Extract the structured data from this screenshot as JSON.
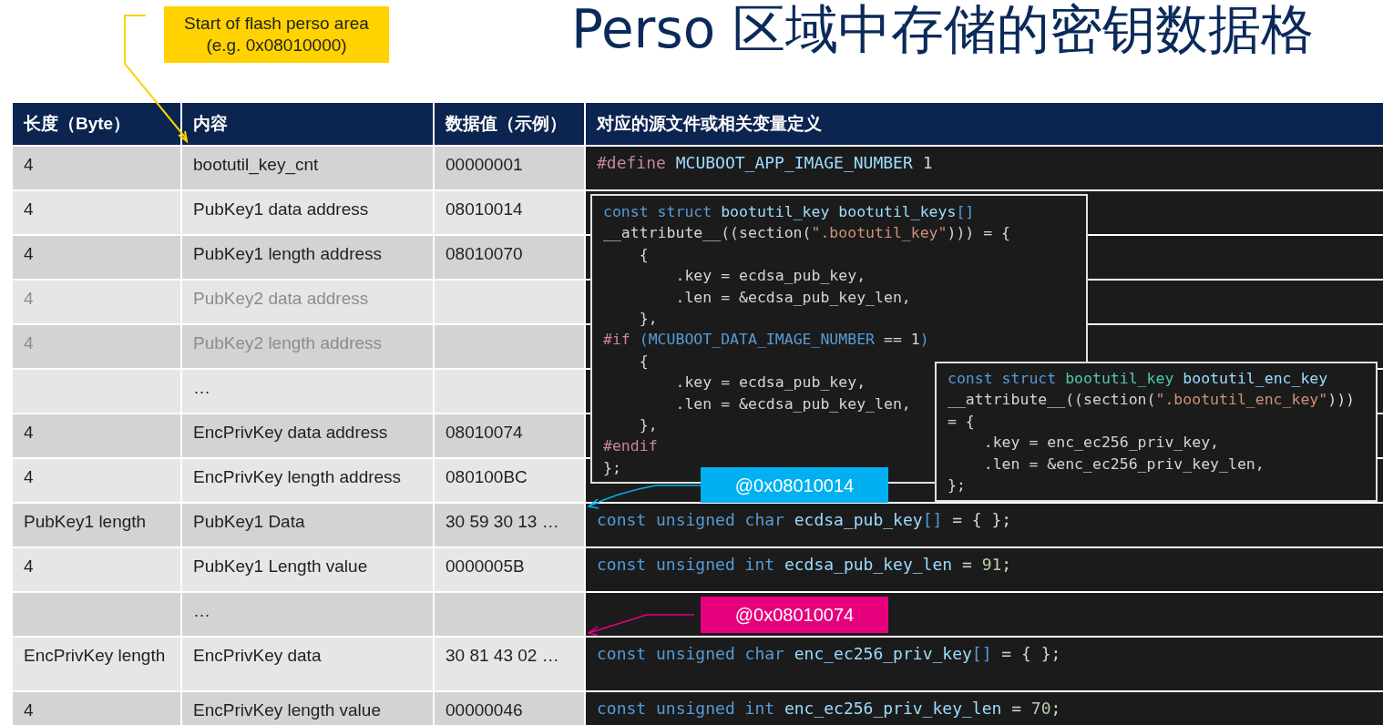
{
  "title": "Perso 区域中存储的密钥数据格",
  "callouts": [
    {
      "text": "Start of flash perso area",
      "subtext": "(e.g. 0x08010000)",
      "color": "#ffd200"
    },
    {
      "text": "@0x08010014",
      "color": "#00b0f0"
    },
    {
      "text": "@0x08010074",
      "color": "#e6007e"
    }
  ],
  "table": {
    "columns": [
      "长度（Byte）",
      "内容",
      "数据值（示例）",
      "对应的源文件或相关变量定义"
    ],
    "rows": [
      {
        "cells": [
          "4",
          "bootutil_key_cnt",
          "00000001"
        ],
        "disabled": false,
        "code": [
          {
            "kind": "pre",
            "text": "#define "
          },
          {
            "kind": "id",
            "text": "MCUBOOT_APP_IMAGE_NUMBER"
          },
          {
            "kind": "plain",
            "text": " 1"
          }
        ]
      },
      {
        "cells": [
          "4",
          "PubKey1 data address",
          "08010014"
        ],
        "disabled": false
      },
      {
        "cells": [
          "4",
          "PubKey1 length address",
          "08010070"
        ],
        "disabled": false
      },
      {
        "cells": [
          "4",
          "PubKey2 data address",
          ""
        ],
        "disabled": true
      },
      {
        "cells": [
          "4",
          "PubKey2 length address",
          ""
        ],
        "disabled": true
      },
      {
        "cells": [
          "",
          "…",
          ""
        ],
        "disabled": false
      },
      {
        "cells": [
          "4",
          "EncPrivKey data address",
          "08010074"
        ],
        "disabled": false
      },
      {
        "cells": [
          "4",
          "EncPrivKey length address",
          "080100BC"
        ],
        "disabled": false
      },
      {
        "cells": [
          "PubKey1 length",
          "PubKey1 Data",
          "30 59 30 13 …"
        ],
        "disabled": false,
        "code": [
          {
            "kind": "kw",
            "text": "const unsigned char "
          },
          {
            "kind": "id",
            "text": "ecdsa_pub_key"
          },
          {
            "kind": "kw",
            "text": "[]"
          },
          {
            "kind": "plain",
            "text": " = { };"
          }
        ]
      },
      {
        "cells": [
          "4",
          "PubKey1 Length value",
          "0000005B"
        ],
        "disabled": false,
        "code": [
          {
            "kind": "kw",
            "text": "const unsigned int "
          },
          {
            "kind": "id",
            "text": "ecdsa_pub_key_len"
          },
          {
            "kind": "plain",
            "text": " = "
          },
          {
            "kind": "num",
            "text": "91"
          },
          {
            "kind": "plain",
            "text": ";"
          }
        ]
      },
      {
        "cells": [
          "",
          "…",
          ""
        ],
        "disabled": false
      },
      {
        "cells": [
          "EncPrivKey length",
          "EncPrivKey data",
          "30 81 43 02 …"
        ],
        "disabled": false,
        "code": [
          {
            "kind": "kw",
            "text": "const unsigned char "
          },
          {
            "kind": "id",
            "text": "enc_ec256_priv_key"
          },
          {
            "kind": "kw",
            "text": "[]"
          },
          {
            "kind": "plain",
            "text": " = { };"
          }
        ]
      },
      {
        "cells": [
          "4",
          "EncPrivKey length value",
          "00000046"
        ],
        "disabled": false,
        "code": [
          {
            "kind": "kw",
            "text": "const unsigned int "
          },
          {
            "kind": "id",
            "text": "enc_ec256_priv_key_len"
          },
          {
            "kind": "plain",
            "text": " = "
          },
          {
            "kind": "num",
            "text": "70"
          },
          {
            "kind": "plain",
            "text": ";"
          }
        ]
      }
    ]
  },
  "code_boxes": [
    {
      "lines": [
        [
          {
            "kind": "kw",
            "text": "const struct "
          },
          {
            "kind": "id",
            "text": "bootutil_key bootutil_keys"
          },
          {
            "kind": "kw",
            "text": "[]"
          }
        ],
        [
          {
            "kind": "plain",
            "text": "__attribute__((section("
          },
          {
            "kind": "str",
            "text": "\".bootutil_key\""
          },
          {
            "kind": "plain",
            "text": "))) = {"
          }
        ],
        [
          {
            "kind": "plain",
            "text": "    {"
          }
        ],
        [
          {
            "kind": "plain",
            "text": "        .key = ecdsa_pub_key,"
          }
        ],
        [
          {
            "kind": "plain",
            "text": "        .len = &ecdsa_pub_key_len,"
          }
        ],
        [
          {
            "kind": "plain",
            "text": "    },"
          }
        ],
        [
          {
            "kind": "pre",
            "text": "#if "
          },
          {
            "kind": "kw",
            "text": "(MCUBOOT_DATA_IMAGE_NUMBER"
          },
          {
            "kind": "plain",
            "text": " == 1"
          },
          {
            "kind": "kw",
            "text": ")"
          }
        ],
        [
          {
            "kind": "plain",
            "text": "    {"
          }
        ],
        [
          {
            "kind": "plain",
            "text": "        .key = ecdsa_pub_key,"
          }
        ],
        [
          {
            "kind": "plain",
            "text": "        .len = &ecdsa_pub_key_len,"
          }
        ],
        [
          {
            "kind": "plain",
            "text": "    },"
          }
        ],
        [
          {
            "kind": "pre",
            "text": "#endif"
          }
        ],
        [
          {
            "kind": "plain",
            "text": "};"
          }
        ]
      ]
    },
    {
      "lines": [
        [
          {
            "kind": "kw",
            "text": "const struct "
          },
          {
            "kind": "type",
            "text": "bootutil_key"
          },
          {
            "kind": "id",
            "text": " bootutil_enc_key"
          }
        ],
        [
          {
            "kind": "plain",
            "text": "__attribute__((section("
          },
          {
            "kind": "str",
            "text": "\".bootutil_enc_key\""
          },
          {
            "kind": "plain",
            "text": ")))"
          }
        ],
        [
          {
            "kind": "plain",
            "text": "= {"
          }
        ],
        [
          {
            "kind": "plain",
            "text": "    .key = enc_ec256_priv_key,"
          }
        ],
        [
          {
            "kind": "plain",
            "text": "    .len = &enc_ec256_priv_key_len,"
          }
        ],
        [
          {
            "kind": "plain",
            "text": "};"
          }
        ]
      ]
    }
  ]
}
